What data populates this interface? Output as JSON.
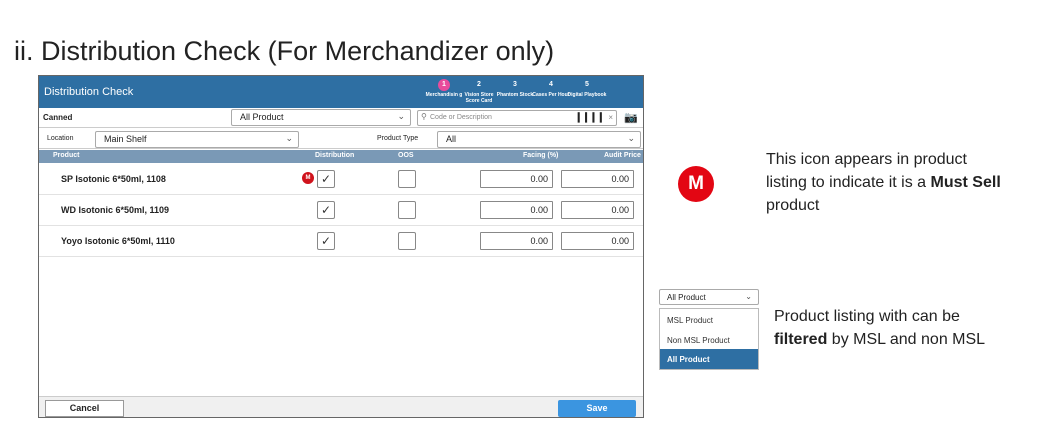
{
  "heading": "ii. Distribution Check (For Merchandizer only)",
  "app": {
    "title": "Distribution Check",
    "steps": [
      {
        "num": "1",
        "label": "Merchandisin g",
        "active": true
      },
      {
        "num": "2",
        "label": "Vision Store Score Card",
        "active": false
      },
      {
        "num": "3",
        "label": "Phantom Stock",
        "active": false
      },
      {
        "num": "4",
        "label": "Cases Per Hour",
        "active": false
      },
      {
        "num": "5",
        "label": "Digital Playbook",
        "active": false
      }
    ],
    "filter": {
      "canned_label": "Canned",
      "product_filter_value": "All Product",
      "search_placeholder": "Code or Description",
      "location_label": "Location",
      "location_value": "Main Shelf",
      "product_type_label": "Product Type",
      "product_type_value": "All"
    },
    "columns": {
      "product": "Product",
      "distribution": "Distribution",
      "oos": "OOS",
      "facing": "Facing (%)",
      "audit_price": "Audit Price"
    },
    "rows": [
      {
        "name": "SP Isotonic 6*50ml, 1108",
        "must_sell": true,
        "distribution": true,
        "oos": false,
        "facing": "0.00",
        "audit_price": "0.00"
      },
      {
        "name": "WD Isotonic 6*50ml, 1109",
        "must_sell": false,
        "distribution": true,
        "oos": false,
        "facing": "0.00",
        "audit_price": "0.00"
      },
      {
        "name": "Yoyo Isotonic 6*50ml, 1110",
        "must_sell": false,
        "distribution": true,
        "oos": false,
        "facing": "0.00",
        "audit_price": "0.00"
      }
    ],
    "msl_badge": "M",
    "cancel_label": "Cancel",
    "save_label": "Save"
  },
  "annotations": {
    "badge": "M",
    "note1_a": "This icon appears in product",
    "note1_b": "listing to indicate it is a ",
    "note1_bold": "Must Sell",
    "note1_c": "product",
    "dropdown_value": "All Product",
    "dropdown_options": [
      "MSL Product",
      "Non MSL Product",
      "All Product"
    ],
    "note2_a": "Product listing with can be",
    "note2_bold": "filtered",
    "note2_b": " by MSL and non MSL"
  },
  "colors": {
    "header_blue": "#2e6fa3",
    "step_active": "#e84c9c",
    "table_header": "#7a99b6",
    "save_button": "#3b95e0",
    "must_sell_red": "#e30613"
  },
  "icons": {
    "search": "magnifier-icon",
    "barcode": "barcode-icon",
    "camera": "camera-icon",
    "check": "check-icon",
    "chevron": "chevron-down-icon"
  }
}
